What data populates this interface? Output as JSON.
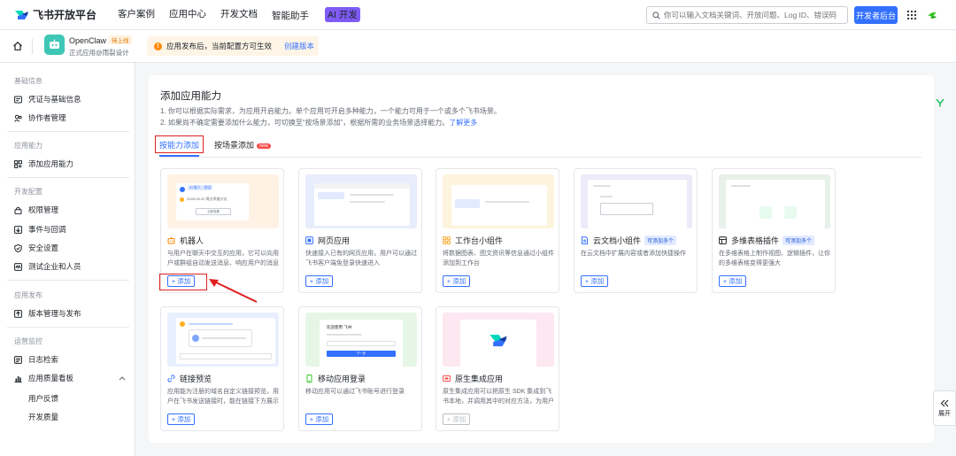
{
  "topbar": {
    "brand": "飞书开放平台",
    "nav": [
      "客户案例",
      "应用中心",
      "开发文档",
      "智能助手"
    ],
    "ai_badge": "AI 开发",
    "search_placeholder": "你可以输入文档关键词、开放问题、Log ID、错误码",
    "dev_console": "开发者后台"
  },
  "appbar": {
    "app_name": "OpenClaw",
    "status_badge": "待上线",
    "app_type": "正式应用@雨裂设计",
    "notice": "应用发布后，当前配置方可生效",
    "notice_link": "创建版本"
  },
  "sidebar": {
    "groups": [
      "基础信息",
      "应用能力",
      "开发配置",
      "应用发布",
      "运营监控"
    ],
    "items": [
      "凭证与基础信息",
      "协作者管理",
      "添加应用能力",
      "权限管理",
      "事件与回调",
      "安全设置",
      "测试企业和人员",
      "版本管理与发布",
      "日志检索",
      "应用质量看板"
    ],
    "subitems": [
      "用户反馈",
      "开发质量"
    ]
  },
  "main": {
    "title": "添加应用能力",
    "desc1": "1. 你可以根据实际需求，为应用开启能力。单个应用可开启多种能力，一个能力可用于一个或多个飞书场景。",
    "desc2": "2. 如果尚不确定需要添加什么能力，可切换至“按场景添加”，根据所需的业务场景选择能力。",
    "desc2_link": "了解更多",
    "tab_active": "按能力添加",
    "tab_other": "按场景添加",
    "new_badge": "new",
    "add_label": "+ 添加",
    "expand_label": "展开"
  },
  "cards": [
    {
      "title": "机器人",
      "tag": "",
      "desc": "与用户在聊天中交互的应用，它可以向用户或群组自动发送消息、响应用户的消息",
      "icon": "robot-icon",
      "enabled": true
    },
    {
      "title": "网页应用",
      "tag": "",
      "desc": "快速接入已有的网页应用，用户可以通过飞书客户端免登录快速进入",
      "icon": "webpage-icon",
      "enabled": true
    },
    {
      "title": "工作台小组件",
      "tag": "",
      "desc": "将数据图表、图文资讯等信息通过小组件添加到工作台",
      "icon": "widget-icon",
      "enabled": true
    },
    {
      "title": "云文档小组件",
      "tag": "可添加多个",
      "desc": "在云文档中扩展内容或者添加快捷操作",
      "icon": "doc-icon",
      "enabled": true
    },
    {
      "title": "多维表格插件",
      "tag": "可添加多个",
      "desc": "在多维表格上制作视图、逻辑插件，让你的多维表格变得更强大",
      "icon": "base-icon",
      "enabled": true
    },
    {
      "title": "链接预览",
      "tag": "",
      "desc": "应用能为注册的域名自定义链接预览，用户在飞书发送链接时，能在链接下方展示预览卡片",
      "icon": "link-icon",
      "enabled": true
    },
    {
      "title": "移动应用登录",
      "tag": "",
      "desc": "移动应用可以通过飞书账号进行登录",
      "icon": "mobile-icon",
      "enabled": true
    },
    {
      "title": "原生集成应用",
      "tag": "",
      "desc": "原生集成应用可以把原生 SDK 集成到飞书本地，并调用其中的对应方法，为用户提供服务",
      "icon": "native-icon",
      "enabled": false
    }
  ],
  "thumb_texts": {
    "bot_name": "AI 助人 · 测试",
    "bot_msg": "2025-05-20 周五季度讨论",
    "bot_btn": "立即查看",
    "mobile_title": "欢迎使用 飞书",
    "mobile_btn": "下一步"
  },
  "colors": {
    "accent": "#3370ff",
    "highlight": "#e02020"
  }
}
